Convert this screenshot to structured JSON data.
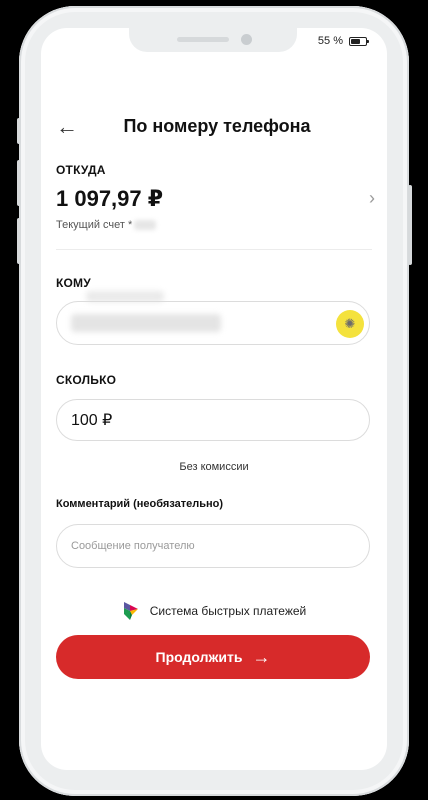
{
  "status_bar": {
    "battery_text": "55 %"
  },
  "header": {
    "title": "По номеру телефона",
    "back_icon": "←"
  },
  "from": {
    "label": "ОТКУДА",
    "amount": "1 097,97 ₽",
    "account_label": "Текущий счет *",
    "chevron": "›"
  },
  "to": {
    "label": "КОМУ"
  },
  "amount": {
    "label": "СКОЛЬКО",
    "value": "100 ₽",
    "fee_note": "Без комиссии"
  },
  "comment": {
    "label": "Комментарий (необязательно)",
    "placeholder": "Сообщение получателю"
  },
  "sbp": {
    "label": "Система быстрых платежей"
  },
  "continue_button": {
    "label": "Продолжить",
    "icon": "→"
  },
  "colors": {
    "accent": "#d72a2a",
    "contact_button": "#f4e23d"
  }
}
